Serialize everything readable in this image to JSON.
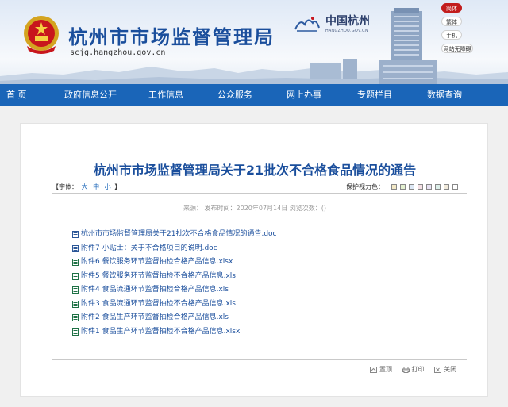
{
  "header": {
    "title": "杭州市市场监督管理局",
    "domain": "scjg.hangzhou.gov.cn",
    "city_logo_text": "中国杭州",
    "city_logo_sub": "HANGZHOU.GOV.CN",
    "side_links": [
      {
        "label": "简体",
        "active": true
      },
      {
        "label": "繁体",
        "active": false
      },
      {
        "label": "手机",
        "active": false
      },
      {
        "label": "网站无障碍",
        "active": false
      }
    ]
  },
  "nav": {
    "items": [
      {
        "label": "首  页"
      },
      {
        "label": "政府信息公开"
      },
      {
        "label": "工作信息"
      },
      {
        "label": "公众服务"
      },
      {
        "label": "网上办事"
      },
      {
        "label": "专题栏目"
      },
      {
        "label": "数据查询"
      }
    ]
  },
  "article": {
    "title": "杭州市市场监督管理局关于21批次不合格食品情况的通告",
    "font_label": "【字体：",
    "font_sizes": [
      "大",
      "中",
      "小"
    ],
    "font_label_end": "】",
    "eye_label": "保护视力色：",
    "eye_colors": [
      "#f3e9c6",
      "#e4f1d0",
      "#dde8f5",
      "#f4dfe4",
      "#e8e2f3",
      "#dcefe9",
      "#f1eadb",
      "#ffffff"
    ],
    "meta": "来源：  发布时间：2020年07月14日  浏览次数：()",
    "files": [
      {
        "label": "杭州市市场监督管理局关于21批次不合格食品情况的通告.doc",
        "type": "doc"
      },
      {
        "label": "附件7 小贴士：关于不合格项目的说明.doc",
        "type": "doc"
      },
      {
        "label": "附件6 餐饮服务环节监督抽检合格产品信息.xlsx",
        "type": "xls"
      },
      {
        "label": "附件5 餐饮服务环节监督抽检不合格产品信息.xls",
        "type": "xls"
      },
      {
        "label": "附件4 食品流通环节监督抽检合格产品信息.xls",
        "type": "xls"
      },
      {
        "label": "附件3 食品流通环节监督抽检不合格产品信息.xls",
        "type": "xls"
      },
      {
        "label": "附件2 食品生产环节监督抽检合格产品信息.xls",
        "type": "xls"
      },
      {
        "label": "附件1 食品生产环节监督抽检不合格产品信息.xlsx",
        "type": "xls"
      }
    ],
    "actions": [
      {
        "label": "置顶",
        "icon": "top-icon"
      },
      {
        "label": "打印",
        "icon": "print-icon"
      },
      {
        "label": "关闭",
        "icon": "close-icon"
      }
    ]
  },
  "colors": {
    "nav_bg": "#1a65b8",
    "title_blue": "#1a4e9c",
    "link_blue": "#1a4e9c",
    "active_red": "#c21d1d"
  }
}
